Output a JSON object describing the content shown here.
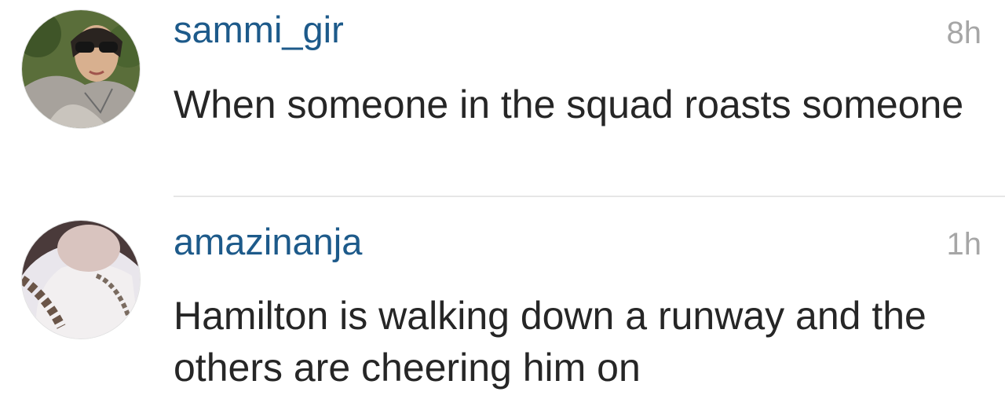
{
  "comments": [
    {
      "username": "sammi_gir",
      "time": "8h",
      "text": "When someone in the squad roasts someone",
      "avatar_icon": "user-photo-sunglasses"
    },
    {
      "username": "amazinanja",
      "time": "1h",
      "text": "Hamilton is walking down a runway and the others are cheering him on",
      "avatar_icon": "user-photo-braid"
    }
  ],
  "colors": {
    "username": "#1d5a8a",
    "timestamp": "#a6a6a6",
    "text": "#262626",
    "divider": "#e6e6e6"
  }
}
